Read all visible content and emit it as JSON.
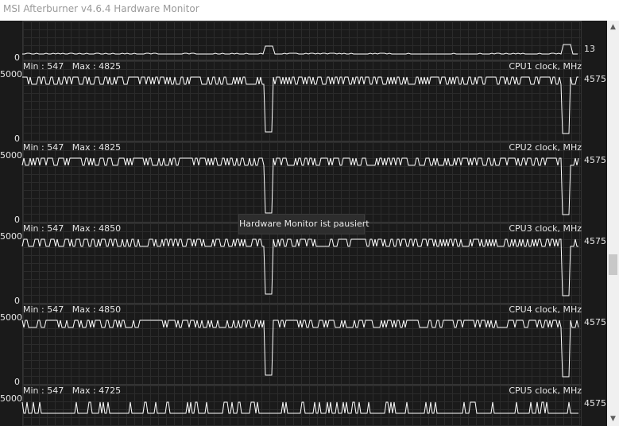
{
  "window": {
    "title": "MSI Afterburner v4.6.4 Hardware Monitor"
  },
  "tooltip": "Hardware Monitor ist pausiert",
  "top_graph": {
    "axis_min": "0",
    "current_value": "13"
  },
  "graphs": [
    {
      "name": "CPU1 clock, MHz",
      "min_label": "Min : 547",
      "max_label": "Max : 4825",
      "axis_max": "5000",
      "axis_min": "0",
      "current_value": "4575"
    },
    {
      "name": "CPU2 clock, MHz",
      "min_label": "Min : 547",
      "max_label": "Max : 4825",
      "axis_max": "5000",
      "axis_min": "0",
      "current_value": "4575"
    },
    {
      "name": "CPU3 clock, MHz",
      "min_label": "Min : 547",
      "max_label": "Max : 4850",
      "axis_max": "5000",
      "axis_min": "0",
      "current_value": "4575"
    },
    {
      "name": "CPU4 clock, MHz",
      "min_label": "Min : 547",
      "max_label": "Max : 4850",
      "axis_max": "5000",
      "axis_min": "0",
      "current_value": "4575"
    },
    {
      "name": "CPU5 clock, MHz",
      "min_label": "Min : 547",
      "max_label": "Max : 4725",
      "axis_max": "5000",
      "axis_min": "",
      "current_value": "4575"
    }
  ],
  "colors": {
    "trace": "#ffffff",
    "background": "#1a1a1a",
    "grid": "#2b2b2b"
  },
  "icons": {
    "scroll_up": "triangle-up-icon",
    "scroll_down": "triangle-down-icon"
  }
}
